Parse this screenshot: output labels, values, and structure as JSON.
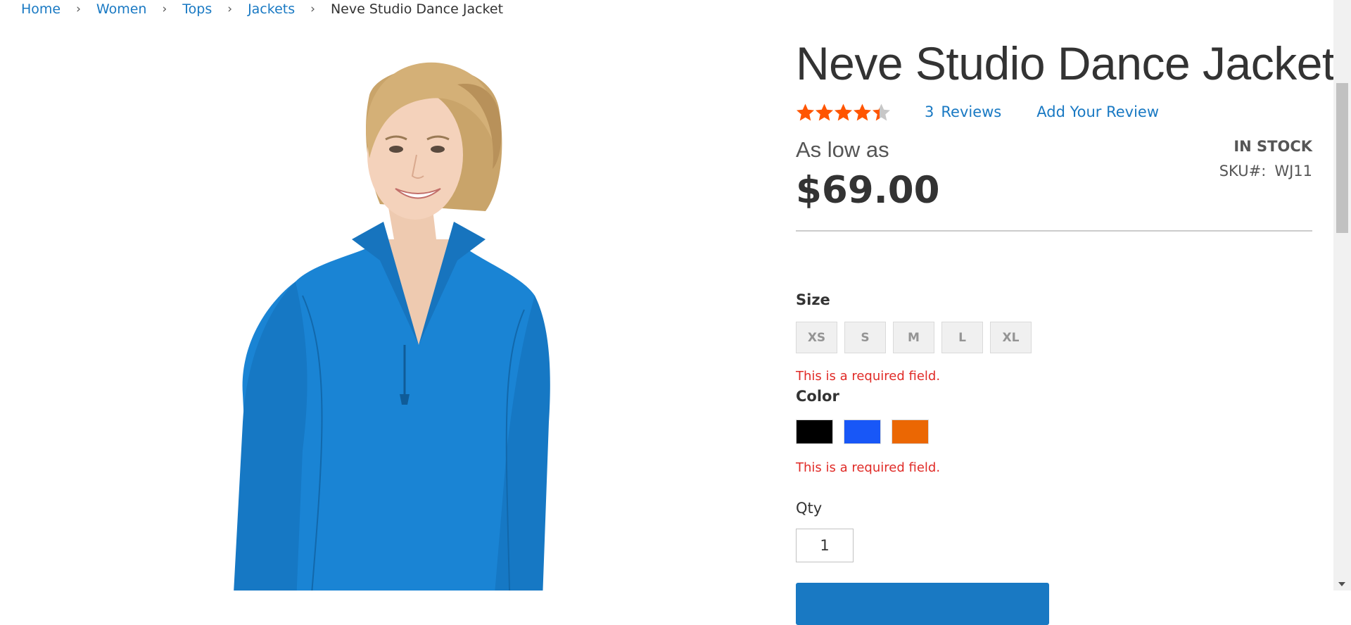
{
  "breadcrumb": {
    "items": [
      "Home",
      "Women",
      "Tops",
      "Jackets"
    ],
    "separator": "›",
    "current": "Neve Studio Dance Jacket"
  },
  "product": {
    "name": "Neve Studio Dance Jacket",
    "rating": {
      "stars_out_of_5": 4.4,
      "review_count": "3",
      "reviews_label": "Reviews",
      "add_review_label": "Add Your Review"
    },
    "price_label": "As low as",
    "price": "$69.00",
    "stock": "IN STOCK",
    "sku_label": "SKU#:",
    "sku": "WJ11",
    "image_icon": "product-photo-woman-blue-jacket"
  },
  "options": {
    "size": {
      "label": "Size",
      "values": [
        "XS",
        "S",
        "M",
        "L",
        "XL"
      ],
      "error": "This is a required field."
    },
    "color": {
      "label": "Color",
      "swatches": [
        "#000000",
        "#1857f7",
        "#eb6703"
      ],
      "error": "This is a required field."
    }
  },
  "qty": {
    "label": "Qty",
    "value": "1"
  },
  "colors": {
    "link": "#1979c3",
    "error": "#e02b27",
    "star": "#ff5501",
    "star_empty": "#c7c7c7",
    "button": "#1979c3"
  }
}
